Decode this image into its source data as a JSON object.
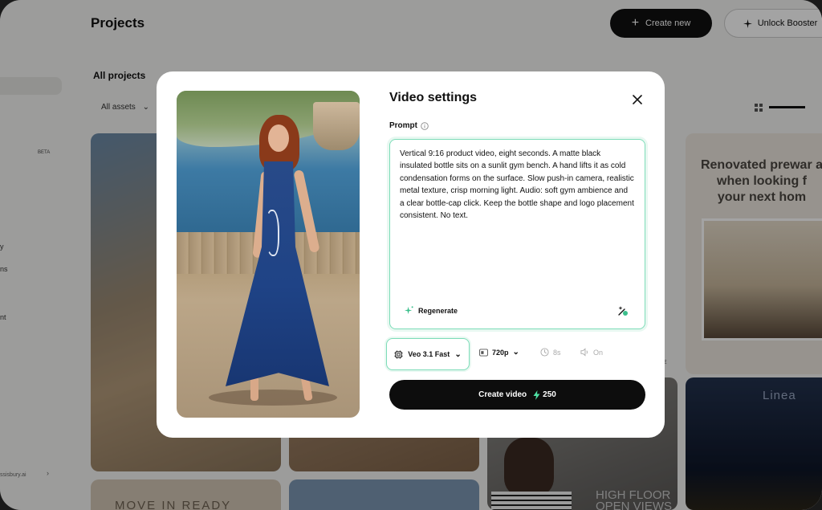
{
  "header": {
    "title": "Projects",
    "create_new_label": "Create new",
    "unlock_label": "Unlock Booster"
  },
  "tabs": {
    "all_projects": "All projects"
  },
  "filters": {
    "assets": "All assets"
  },
  "sidebar": {
    "beta_badge": "BETA",
    "fragments": [
      "y",
      "ns",
      "nt"
    ],
    "footer_fragment": "ssisbury.ai"
  },
  "cards": {
    "promo_text": "Renovated prewar a when looking f your next hom",
    "promo_line1": "Renovated prewar a",
    "promo_line2": "when looking f",
    "promo_line3": "your next hom",
    "linea": "Linea",
    "move_in": "MOVE IN READY",
    "high_floor_line1": "HIGH FLOOR",
    "high_floor_line2": "OPEN VIEWS",
    "fragment_e": "E"
  },
  "modal": {
    "title": "Video settings",
    "prompt_label": "Prompt",
    "prompt_text": "Vertical 9:16 product video, eight seconds. A matte black insulated bottle sits on a sunlit gym bench. A hand lifts it as cold condensation forms on the surface. Slow push-in camera, realistic metal texture, crisp morning light. Audio: soft gym ambience and a clear bottle-cap click. Keep the bottle shape and logo placement consistent. No text.",
    "regenerate_label": "Regenerate",
    "model": "Veo 3.1 Fast",
    "resolution": "720p",
    "duration": "8s",
    "audio": "On",
    "create_label": "Create video",
    "credits": "250",
    "accent_color": "#7ddcb8"
  }
}
